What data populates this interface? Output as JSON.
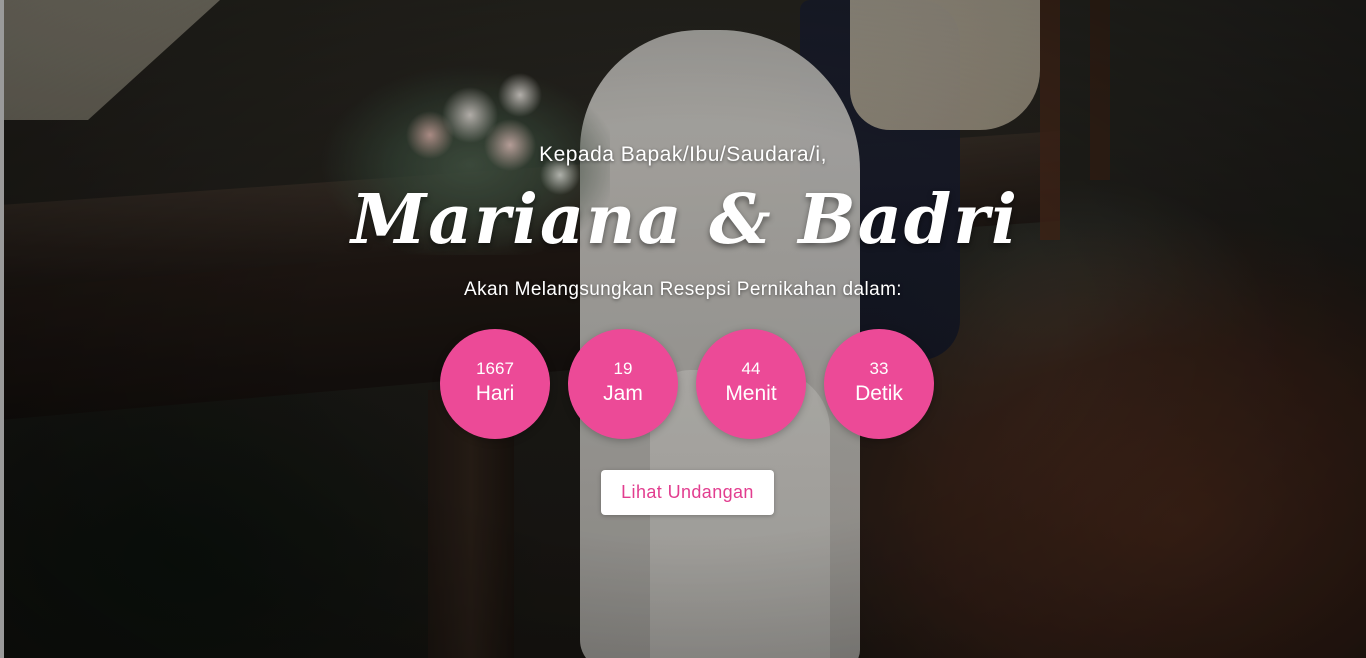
{
  "hero": {
    "greeting": "Kepada Bapak/Ibu/Saudara/i,",
    "couple": "Mariana & Badri",
    "subtitle": "Akan Melangsungkan Resepsi Pernikahan dalam:"
  },
  "countdown": [
    {
      "value": "1667",
      "unit": "Hari"
    },
    {
      "value": "19",
      "unit": "Jam"
    },
    {
      "value": "44",
      "unit": "Menit"
    },
    {
      "value": "33",
      "unit": "Detik"
    }
  ],
  "cta": {
    "label": "Lihat Undangan"
  },
  "colors": {
    "accent": "#ec4a97",
    "button_text": "#e23d8f",
    "button_bg": "#ffffff",
    "text": "#ffffff"
  }
}
